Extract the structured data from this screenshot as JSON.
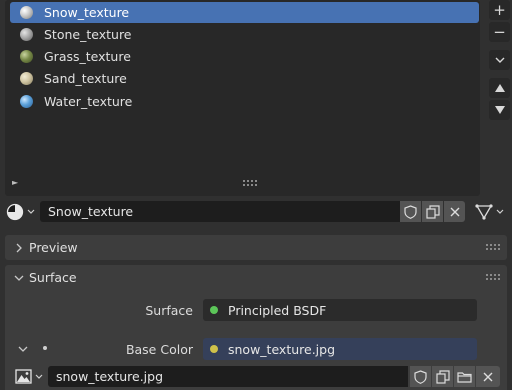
{
  "material_slots": [
    {
      "name": "Snow_texture",
      "active": true,
      "preview": "snow"
    },
    {
      "name": "Stone_texture",
      "active": false,
      "preview": "stone"
    },
    {
      "name": "Grass_texture",
      "active": false,
      "preview": "grass"
    },
    {
      "name": "Sand_texture",
      "active": false,
      "preview": "sand"
    },
    {
      "name": "Water_texture",
      "active": false,
      "preview": "water"
    }
  ],
  "side_buttons": {
    "add": "+",
    "remove": "−",
    "specials": "chevron-down-icon",
    "move_up": "triangle-up-icon",
    "move_down": "triangle-down-icon"
  },
  "material": {
    "name": "Snow_texture",
    "type_icon": "material-sphere-icon"
  },
  "panels": {
    "preview": {
      "title": "Preview",
      "collapsed": true
    },
    "surface": {
      "title": "Surface",
      "collapsed": false
    }
  },
  "surface": {
    "surface_label": "Surface",
    "surface_value": "Principled BSDF",
    "surface_socket_color": "#5cc659",
    "base_color_label": "Base Color",
    "base_color_value": "snow_texture.jpg",
    "base_color_socket_color": "#cfc14a"
  },
  "image": {
    "name": "snow_texture.jpg",
    "type_icon": "image-icon"
  },
  "colors": {
    "accent": "#4772b3",
    "background": "#303030",
    "panel": "#3d3d3d",
    "field": "#1d1d1d"
  }
}
